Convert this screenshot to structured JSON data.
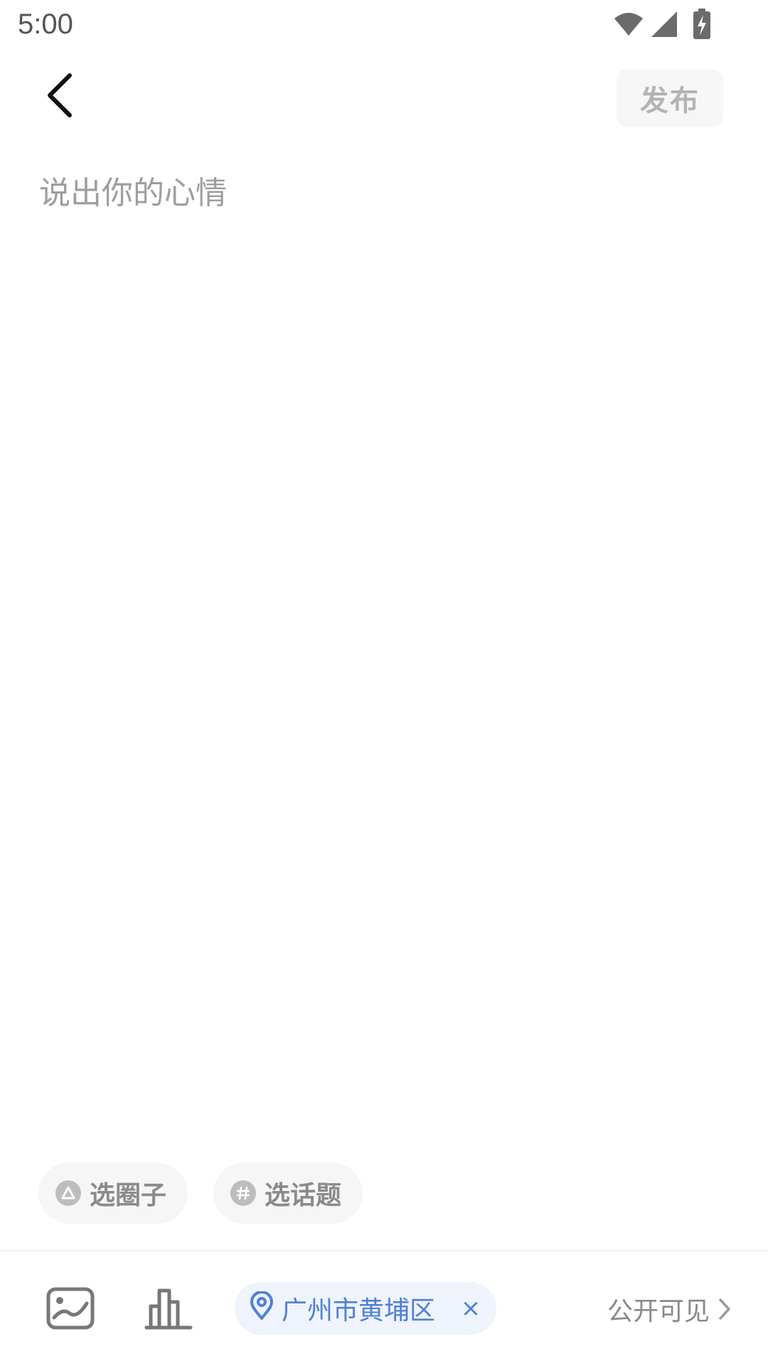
{
  "status_bar": {
    "time": "5:00",
    "icons": [
      "wifi-icon",
      "cellular-signal-icon",
      "battery-charging-icon"
    ]
  },
  "header": {
    "back_icon": "chevron-left-icon",
    "publish_label": "发布"
  },
  "compose": {
    "placeholder": "说出你的心情",
    "value": ""
  },
  "chips": {
    "circle_label": "选圈子",
    "circle_icon": "circle-group-icon",
    "topic_label": "选话题",
    "topic_icon": "hashtag-icon"
  },
  "toolbar": {
    "image_icon": "image-icon",
    "chart_icon": "bar-chart-icon",
    "location": "广州市黄埔区",
    "location_icon": "location-pin-icon",
    "location_close": "×",
    "visibility_label": "公开可见",
    "visibility_icon": "chevron-right-icon"
  },
  "colors": {
    "accent": "#4f7fd6",
    "chip_bg": "#f6f6f6",
    "location_bg": "#eef3fc",
    "muted_text": "#8a8a8a"
  }
}
